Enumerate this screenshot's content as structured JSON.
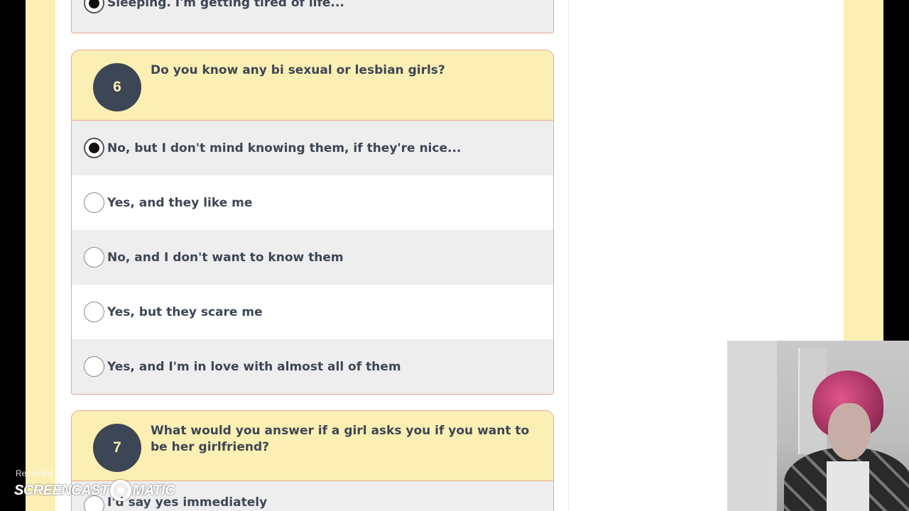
{
  "prev_question": {
    "selected_answer": "Sleeping. I'm getting tired of life..."
  },
  "question6": {
    "number": "6",
    "text": "Do you know any bi sexual or lesbian girls?",
    "options": [
      {
        "label": "No, but I don't mind knowing them, if they're nice...",
        "checked": true
      },
      {
        "label": "Yes, and they like me",
        "checked": false
      },
      {
        "label": "No, and I don't want to know them",
        "checked": false
      },
      {
        "label": "Yes, but they scare me",
        "checked": false
      },
      {
        "label": "Yes, and I'm in love with almost all of them",
        "checked": false
      }
    ]
  },
  "question7": {
    "number": "7",
    "text": "What would you answer if a girl asks you if you want to be her girlfriend?",
    "options": [
      {
        "label": "I'd say yes immediately",
        "checked": false
      }
    ]
  },
  "watermark": {
    "recorded_with": "Recorded with",
    "brand_left": "SCREENCAST",
    "brand_right": "MATIC"
  },
  "colors": {
    "page_background": "#fcefb4",
    "card_border": "#e5a98f",
    "number_badge": "#3d4654",
    "text": "#3d4654"
  }
}
